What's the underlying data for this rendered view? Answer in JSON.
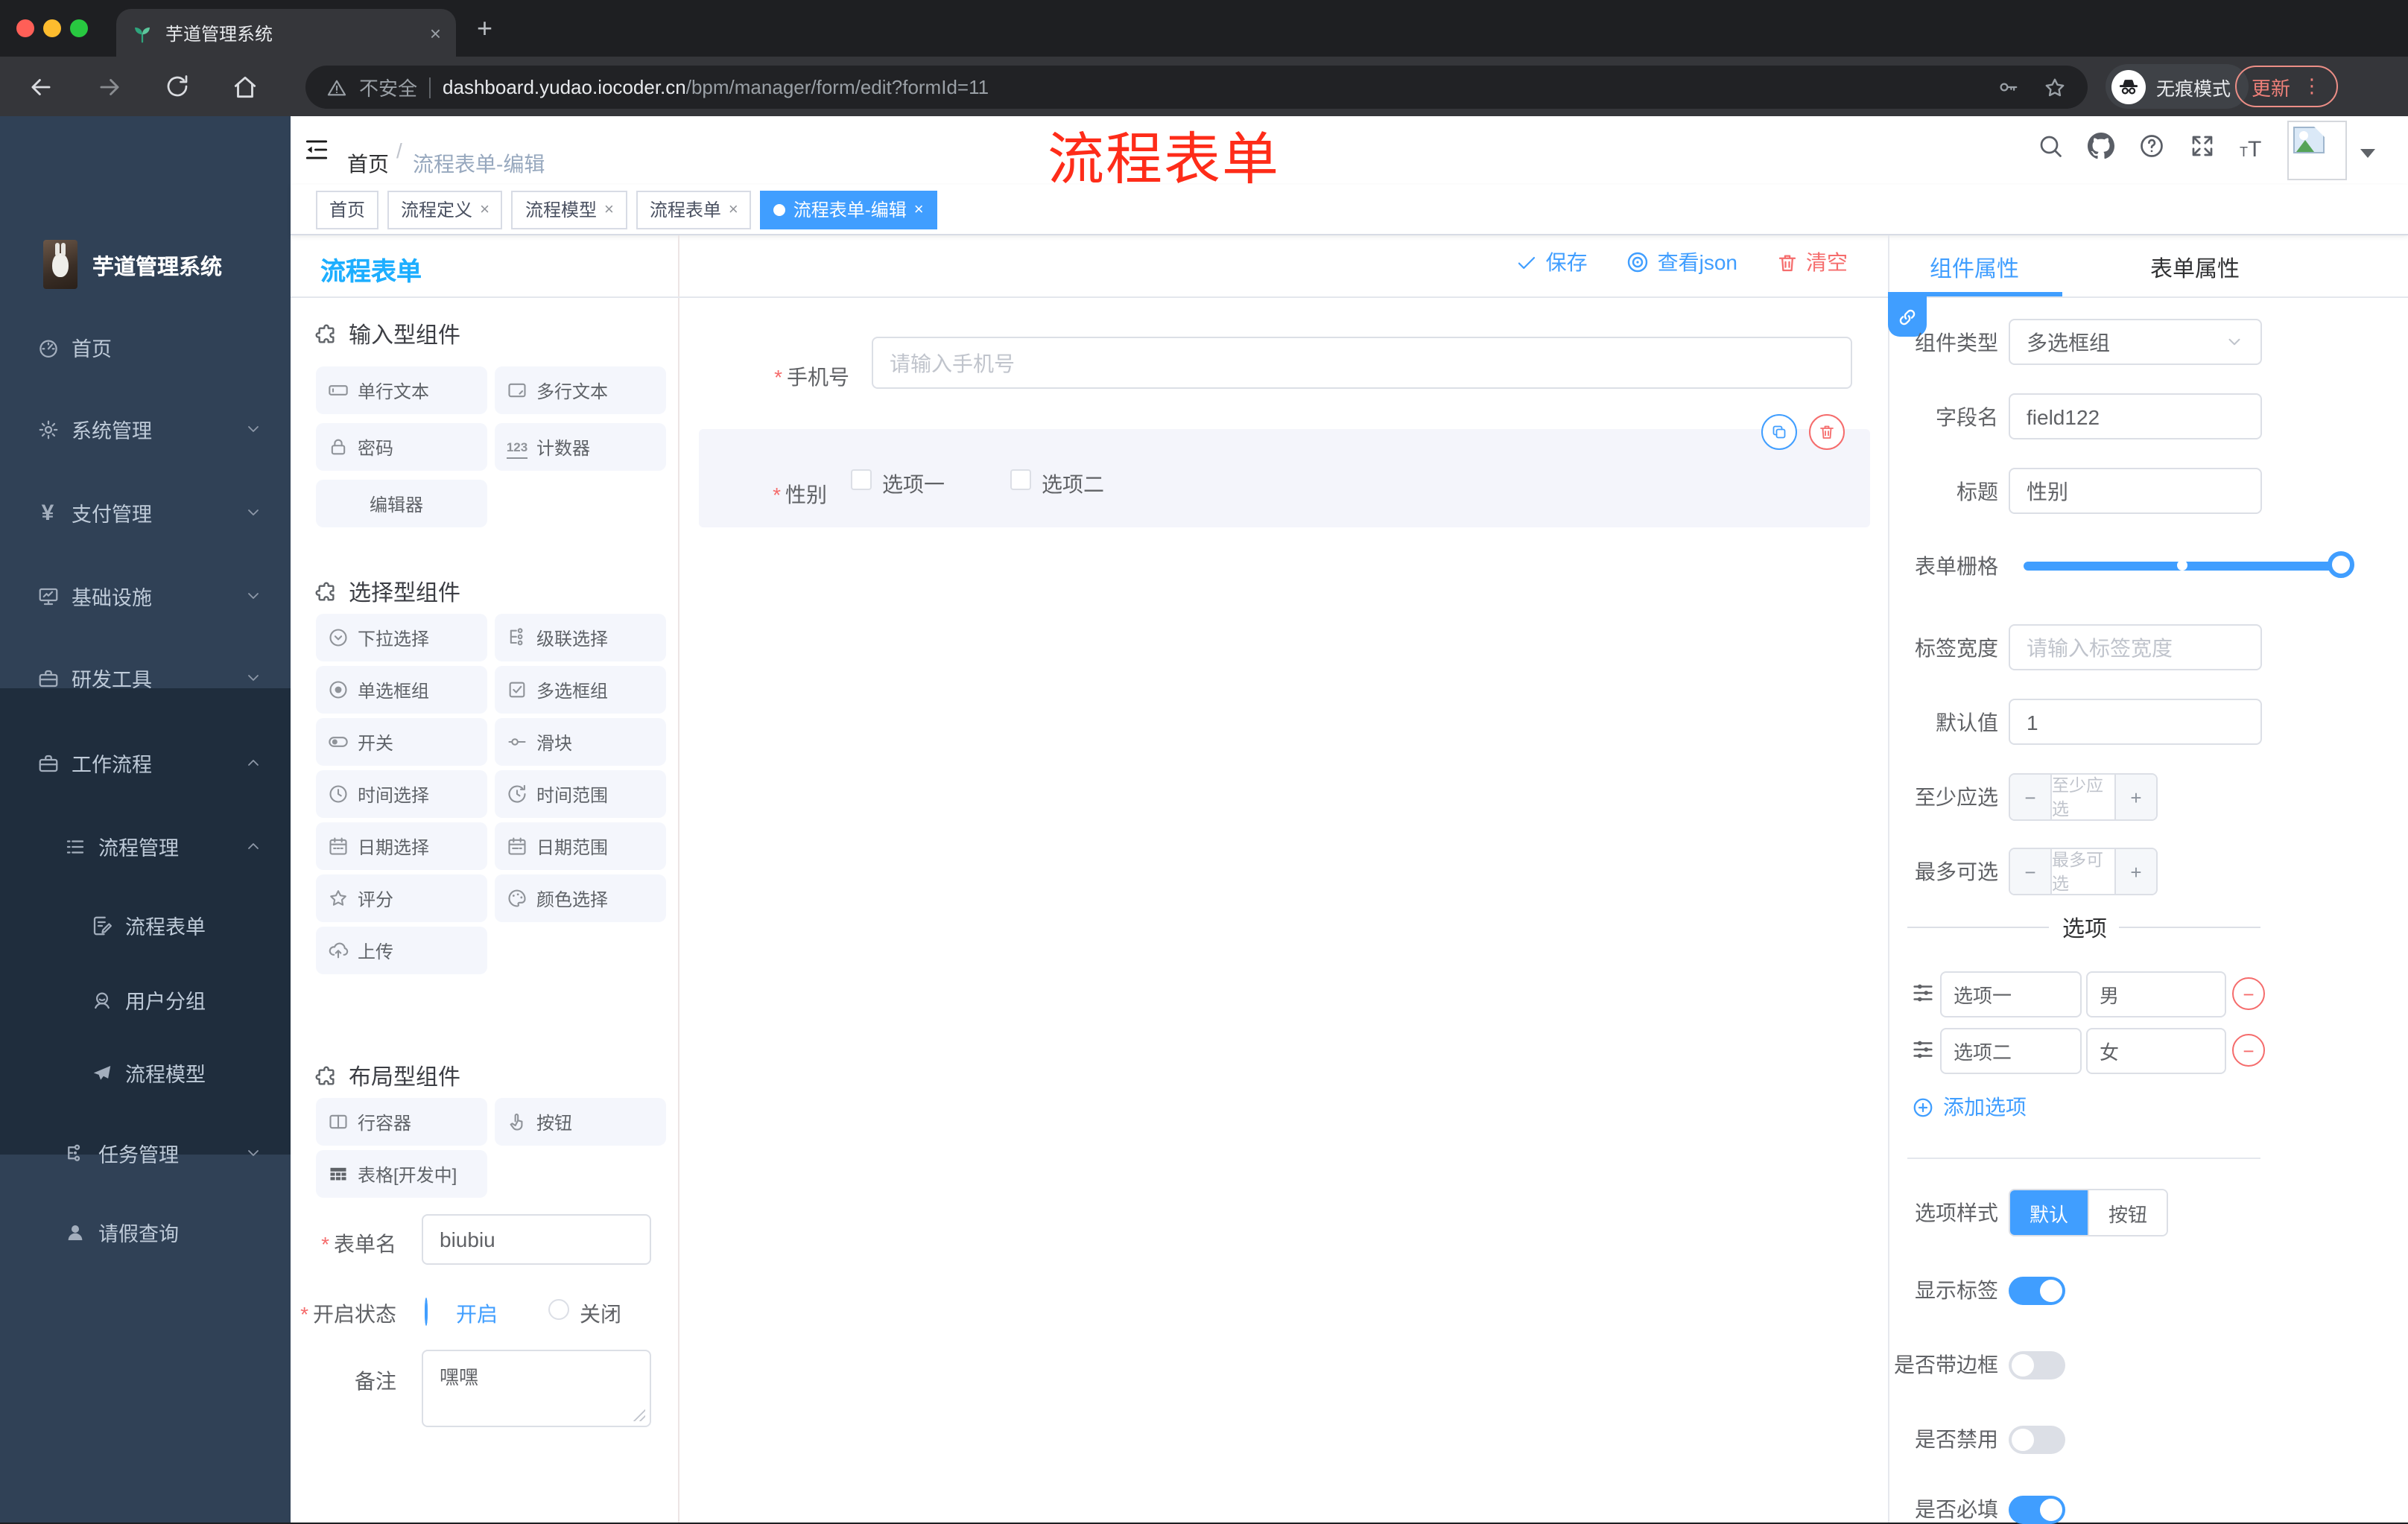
{
  "browser": {
    "tab_title": "芋道管理系统",
    "security_label": "不安全",
    "url_host": "dashboard.yudao.iocoder.cn",
    "url_path": "/bpm/manager/form/edit?formId=11",
    "incognito_label": "无痕模式",
    "update_label": "更新"
  },
  "glyphs": {
    "close": "×",
    "plus": "+",
    "dots": "⋮",
    "minus": "−",
    "add": "+",
    "yen": "¥",
    "counter": "123",
    "question": "?",
    "t_small": "T",
    "t_big": "T"
  },
  "sidebar": {
    "logo_title": "芋道管理系统",
    "items": [
      {
        "label": "首页"
      },
      {
        "label": "系统管理"
      },
      {
        "label": "支付管理"
      },
      {
        "label": "基础设施"
      },
      {
        "label": "研发工具"
      },
      {
        "label": "工作流程"
      },
      {
        "label": "流程管理"
      },
      {
        "label": "流程表单"
      },
      {
        "label": "用户分组"
      },
      {
        "label": "流程模型"
      },
      {
        "label": "任务管理"
      },
      {
        "label": "请假查询"
      }
    ]
  },
  "navbar": {
    "breadcrumb_home": "首页",
    "breadcrumb_sep": "/",
    "breadcrumb_current": "流程表单-编辑",
    "annotation": "流程表单"
  },
  "tags": [
    {
      "label": "首页"
    },
    {
      "label": "流程定义"
    },
    {
      "label": "流程模型"
    },
    {
      "label": "流程表单"
    },
    {
      "label": "流程表单-编辑"
    }
  ],
  "palette": {
    "title": "流程表单",
    "sections": [
      {
        "title": "输入型组件",
        "items": [
          "单行文本",
          "多行文本",
          "密码",
          "计数器",
          "编辑器"
        ]
      },
      {
        "title": "选择型组件",
        "items": [
          "下拉选择",
          "级联选择",
          "单选框组",
          "多选框组",
          "开关",
          "滑块",
          "时间选择",
          "时间范围",
          "日期选择",
          "日期范围",
          "评分",
          "颜色选择",
          "上传"
        ]
      },
      {
        "title": "布局型组件",
        "items": [
          "行容器",
          "按钮",
          "表格[开发中]"
        ]
      }
    ],
    "form": {
      "name_label": "表单名",
      "name_value": "biubiu",
      "status_label": "开启状态",
      "status_on": "开启",
      "status_off": "关闭",
      "remark_label": "备注",
      "remark_value": "嘿嘿"
    }
  },
  "canvas": {
    "save": "保存",
    "view_json": "查看json",
    "clear": "清空",
    "phone_label": "手机号",
    "phone_placeholder": "请输入手机号",
    "gender_label": "性别",
    "gender_opt1": "选项一",
    "gender_opt2": "选项二"
  },
  "props": {
    "tab_component": "组件属性",
    "tab_form": "表单属性",
    "type_label": "组件类型",
    "type_value": "多选框组",
    "field_label": "字段名",
    "field_value": "field122",
    "title_label": "标题",
    "title_value": "性别",
    "grid_label": "表单栅格",
    "width_label": "标签宽度",
    "width_placeholder": "请输入标签宽度",
    "default_label": "默认值",
    "default_value": "1",
    "min_label": "至少应选",
    "min_placeholder": "至少应选",
    "max_label": "最多可选",
    "max_placeholder": "最多可选",
    "options_title": "选项",
    "options": [
      {
        "label": "选项一",
        "value": "男"
      },
      {
        "label": "选项二",
        "value": "女"
      }
    ],
    "add_option": "添加选项",
    "style_label": "选项样式",
    "style_default": "默认",
    "style_button": "按钮",
    "show_label": "显示标签",
    "border_label": "是否带边框",
    "disabled_label": "是否禁用",
    "required_label": "是否必填"
  },
  "colors": {
    "primary": "#409eff",
    "danger": "#f56c6c",
    "panel_title": "#1daeff",
    "annotation_red": "#fe2c19",
    "sidebar_bg": "#304156",
    "submenu_bg": "#1f2d3d"
  }
}
